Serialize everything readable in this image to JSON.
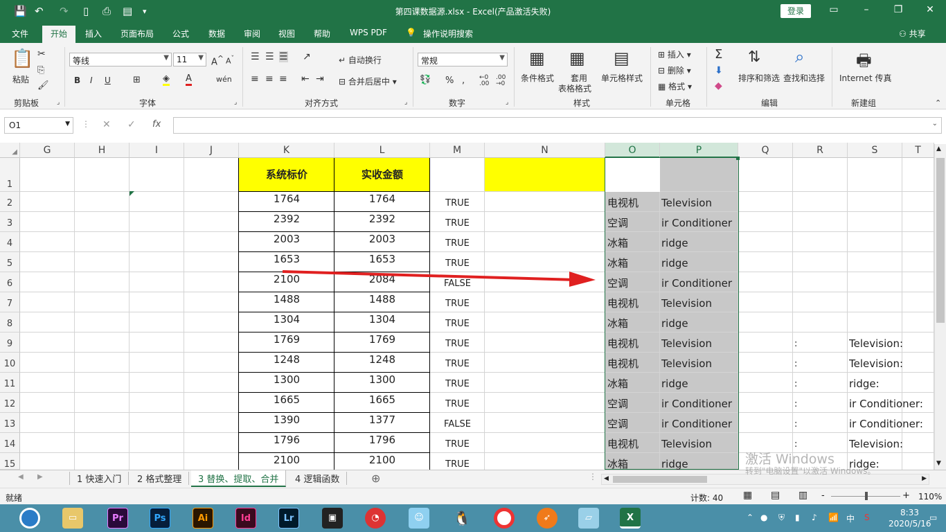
{
  "window": {
    "title": "第四课数据源.xlsx  -  Excel(产品激活失败)",
    "login": "登录"
  },
  "menus": [
    "文件",
    "开始",
    "插入",
    "页面布局",
    "公式",
    "数据",
    "审阅",
    "视图",
    "帮助",
    "WPS PDF",
    "操作说明搜索"
  ],
  "share": "共享",
  "ribbon": {
    "clipboard": {
      "label": "剪贴板",
      "paste": "粘贴"
    },
    "font": {
      "label": "字体",
      "name": "等线",
      "size": "11",
      "bold": "B",
      "italic": "I",
      "underline": "U"
    },
    "align": {
      "label": "对齐方式",
      "wrap": "自动换行",
      "merge": "合并后居中"
    },
    "number": {
      "label": "数字",
      "format": "常规",
      "percent": "%"
    },
    "styles": {
      "label": "样式",
      "cond": "条件格式",
      "table1": "套用",
      "table2": "表格格式",
      "cell": "单元格样式"
    },
    "cells": {
      "label": "单元格",
      "insert": "插入",
      "delete": "删除",
      "format": "格式"
    },
    "edit": {
      "label": "编辑",
      "sort": "排序和筛选",
      "find": "查找和选择"
    },
    "newgroup": {
      "label": "新建组",
      "fax": "Internet 传真"
    }
  },
  "formula": {
    "namebox": "O1",
    "fx": "fx"
  },
  "columns": [
    "G",
    "H",
    "I",
    "J",
    "K",
    "L",
    "M",
    "N",
    "O",
    "P",
    "Q",
    "R",
    "S",
    "T"
  ],
  "rows_numbers": [
    "1",
    "2",
    "3",
    "4",
    "5",
    "6",
    "7",
    "8",
    "9",
    "10",
    "11",
    "12",
    "13",
    "14",
    "15"
  ],
  "headers": {
    "k": "系统标价",
    "l": "实收金额"
  },
  "rows": [
    {
      "k": "1764",
      "l": "1764",
      "m": "TRUE",
      "o": "电视机",
      "p": "Television",
      "r": "",
      "s": ""
    },
    {
      "k": "2392",
      "l": "2392",
      "m": "TRUE",
      "o": "空调",
      "p": "ir Conditioner",
      "r": "",
      "s": ""
    },
    {
      "k": "2003",
      "l": "2003",
      "m": "TRUE",
      "o": "冰箱",
      "p": "ridge",
      "r": "",
      "s": ""
    },
    {
      "k": "1653",
      "l": "1653",
      "m": "TRUE",
      "o": "冰箱",
      "p": "ridge",
      "r": "",
      "s": ""
    },
    {
      "k": "2100",
      "l": "2084",
      "m": "FALSE",
      "o": "空调",
      "p": "ir Conditioner",
      "r": "",
      "s": ""
    },
    {
      "k": "1488",
      "l": "1488",
      "m": "TRUE",
      "o": "电视机",
      "p": "Television",
      "r": "",
      "s": ""
    },
    {
      "k": "1304",
      "l": "1304",
      "m": "TRUE",
      "o": "冰箱",
      "p": "ridge",
      "r": "",
      "s": ""
    },
    {
      "k": "1769",
      "l": "1769",
      "m": "TRUE",
      "o": "电视机",
      "p": "Television",
      "r": ":",
      "s": "Television:"
    },
    {
      "k": "1248",
      "l": "1248",
      "m": "TRUE",
      "o": "电视机",
      "p": "Television",
      "r": ":",
      "s": "Television:"
    },
    {
      "k": "1300",
      "l": "1300",
      "m": "TRUE",
      "o": "冰箱",
      "p": "ridge",
      "r": ":",
      "s": "ridge:"
    },
    {
      "k": "1665",
      "l": "1665",
      "m": "TRUE",
      "o": "空调",
      "p": "ir Conditioner",
      "r": ":",
      "s": "ir Conditioner:"
    },
    {
      "k": "1390",
      "l": "1377",
      "m": "FALSE",
      "o": "空调",
      "p": "ir Conditioner",
      "r": ":",
      "s": "ir Conditioner:"
    },
    {
      "k": "1796",
      "l": "1796",
      "m": "TRUE",
      "o": "电视机",
      "p": "Television",
      "r": ":",
      "s": "Television:"
    },
    {
      "k": "2100",
      "l": "2100",
      "m": "TRUE",
      "o": "冰箱",
      "p": "ridge",
      "r": "",
      "s": "ridge:"
    }
  ],
  "sheets": [
    "1 快速入门",
    "2 格式整理",
    "3 替换、提取、合并",
    "4 逻辑函数"
  ],
  "status": {
    "ready": "就绪",
    "count": "计数: 40",
    "zoom": "110%",
    "minus": "-",
    "plus": "+"
  },
  "watermark": {
    "line1": "激活 Windows",
    "line2": "转到\"电脑设置\"以激活 Windows。"
  },
  "taskbar": {
    "apps": [
      "Pr",
      "Ps",
      "Ai",
      "Id",
      "Lr"
    ],
    "time": "8:33",
    "date": "2020/5/16",
    "ime": "中"
  },
  "colors": {
    "excel_green": "#217346",
    "header_yellow": "#ffff00",
    "selection_gray": "#c8c8c8",
    "arrow_red": "#e02020"
  }
}
